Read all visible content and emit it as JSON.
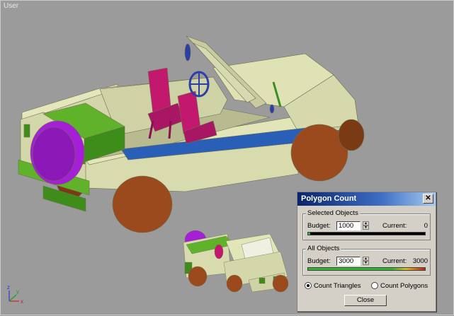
{
  "viewport": {
    "label": "User"
  },
  "gizmo": {
    "x": "x",
    "y": "y",
    "z": "z"
  },
  "dialog": {
    "title": "Polygon Count",
    "selected": {
      "title": "Selected Objects",
      "budget_label": "Budget:",
      "budget_value": "1000",
      "current_label": "Current:",
      "current_value": "0",
      "fill_fraction": 0.02
    },
    "all": {
      "title": "All Objects",
      "budget_label": "Budget:",
      "budget_value": "3000",
      "current_label": "Current:",
      "current_value": "3000",
      "fill_fraction": 1.0
    },
    "radio_triangles": "Count Triangles",
    "radio_polygons": "Count Polygons",
    "selected_mode": "triangles",
    "close_label": "Close"
  },
  "colors": {
    "body": "#d9dcae",
    "seat": "#c2196f",
    "wheel": "#9a4a1c",
    "spare": "#a51fd6",
    "crate": "#5fb22a",
    "accent": "#2a3fa8",
    "bar_green": "#2fb830",
    "bar_warn": "#d8c020",
    "bar_red": "#c02018"
  }
}
